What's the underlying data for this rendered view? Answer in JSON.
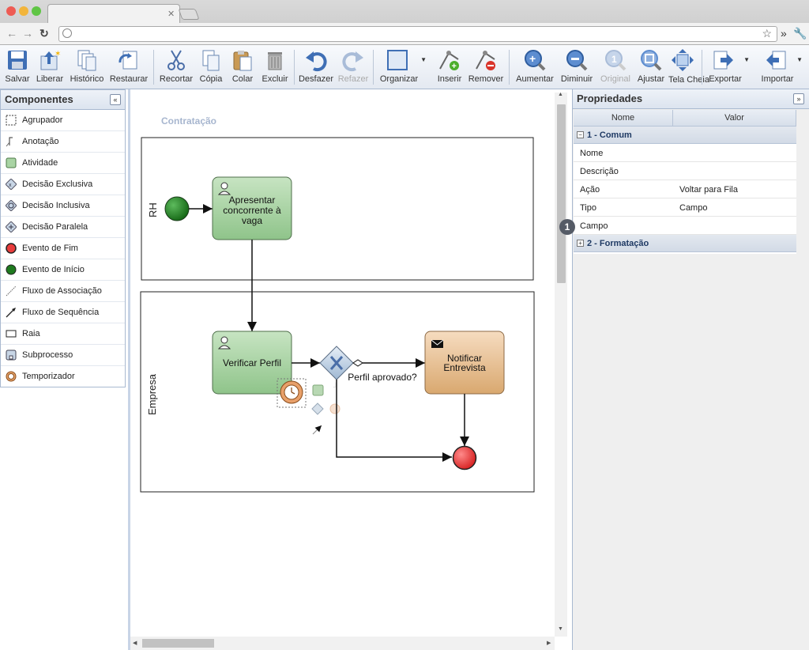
{
  "toolbar": {
    "buttons": [
      {
        "label": "Salvar",
        "icon": "save-icon"
      },
      {
        "label": "Liberar",
        "icon": "release-icon"
      },
      {
        "label": "Histórico",
        "icon": "history-icon"
      },
      {
        "label": "Restaurar",
        "icon": "restore-icon"
      },
      {
        "label": "Recortar",
        "icon": "cut-icon"
      },
      {
        "label": "Cópia",
        "icon": "copy-icon"
      },
      {
        "label": "Colar",
        "icon": "paste-icon"
      },
      {
        "label": "Excluir",
        "icon": "trash-icon"
      },
      {
        "label": "Desfazer",
        "icon": "undo-icon"
      },
      {
        "label": "Refazer",
        "icon": "redo-icon",
        "disabled": true
      },
      {
        "label": "Organizar",
        "icon": "arrange-icon"
      },
      {
        "label": "Inserir",
        "icon": "insert-waypoint-icon"
      },
      {
        "label": "Remover",
        "icon": "remove-waypoint-icon"
      },
      {
        "label": "Aumentar",
        "icon": "zoom-in-icon"
      },
      {
        "label": "Diminuir",
        "icon": "zoom-out-icon"
      },
      {
        "label": "Original",
        "icon": "zoom-original-icon",
        "disabled": true
      },
      {
        "label": "Ajustar",
        "icon": "zoom-fit-icon"
      },
      {
        "label": "Tela Cheia",
        "icon": "fullscreen-icon"
      },
      {
        "label": "Exportar",
        "icon": "export-icon"
      },
      {
        "label": "Importar",
        "icon": "import-icon"
      }
    ]
  },
  "components": {
    "title": "Componentes",
    "collapse_icon": "double-chevron-left-icon",
    "items": [
      {
        "label": "Agrupador",
        "icon": "group-icon"
      },
      {
        "label": "Anotação",
        "icon": "annotation-icon"
      },
      {
        "label": "Atividade",
        "icon": "activity-icon"
      },
      {
        "label": "Decisão Exclusiva",
        "icon": "exclusive-gateway-icon"
      },
      {
        "label": "Decisão Inclusiva",
        "icon": "inclusive-gateway-icon"
      },
      {
        "label": "Decisão Paralela",
        "icon": "parallel-gateway-icon"
      },
      {
        "label": "Evento de Fim",
        "icon": "end-event-icon"
      },
      {
        "label": "Evento de Início",
        "icon": "start-event-icon"
      },
      {
        "label": "Fluxo de Associação",
        "icon": "association-flow-icon"
      },
      {
        "label": "Fluxo de Sequência",
        "icon": "sequence-flow-icon"
      },
      {
        "label": "Raia",
        "icon": "lane-icon"
      },
      {
        "label": "Subprocesso",
        "icon": "subprocess-icon"
      },
      {
        "label": "Temporizador",
        "icon": "timer-icon"
      }
    ]
  },
  "diagram": {
    "title": "Contratação",
    "lanes": [
      {
        "label": "RH"
      },
      {
        "label": "Empresa"
      }
    ],
    "tasks": [
      {
        "label_lines": [
          "Apresentar",
          "concorrente à",
          "vaga"
        ],
        "icon": "user-task-icon"
      },
      {
        "label_lines": [
          "Verificar Perfil"
        ],
        "icon": "user-task-icon"
      },
      {
        "label_lines": [
          "Notificar",
          "Entrevista"
        ],
        "icon": "envelope-icon"
      }
    ],
    "gateway_label": "Perfil aprovado?"
  },
  "properties": {
    "title": "Propriedades",
    "expand_icon": "double-chevron-right-icon",
    "col_name": "Nome",
    "col_value": "Valor",
    "group1": "1 - Comum",
    "group2": "2 - Formatação",
    "rows": [
      {
        "key": "Nome",
        "value": ""
      },
      {
        "key": "Descrição",
        "value": ""
      },
      {
        "key": "Ação",
        "value": "Voltar para Fila"
      },
      {
        "key": "Tipo",
        "value": "Campo"
      },
      {
        "key": "Campo",
        "value": ""
      }
    ],
    "badge": "1"
  },
  "colors": {
    "task_green": "#a9d4a4",
    "task_orange": "#e6c49a",
    "start_event": "#2f8a2f",
    "end_event": "#e83c3c",
    "panel_border": "#a9b9d0"
  }
}
